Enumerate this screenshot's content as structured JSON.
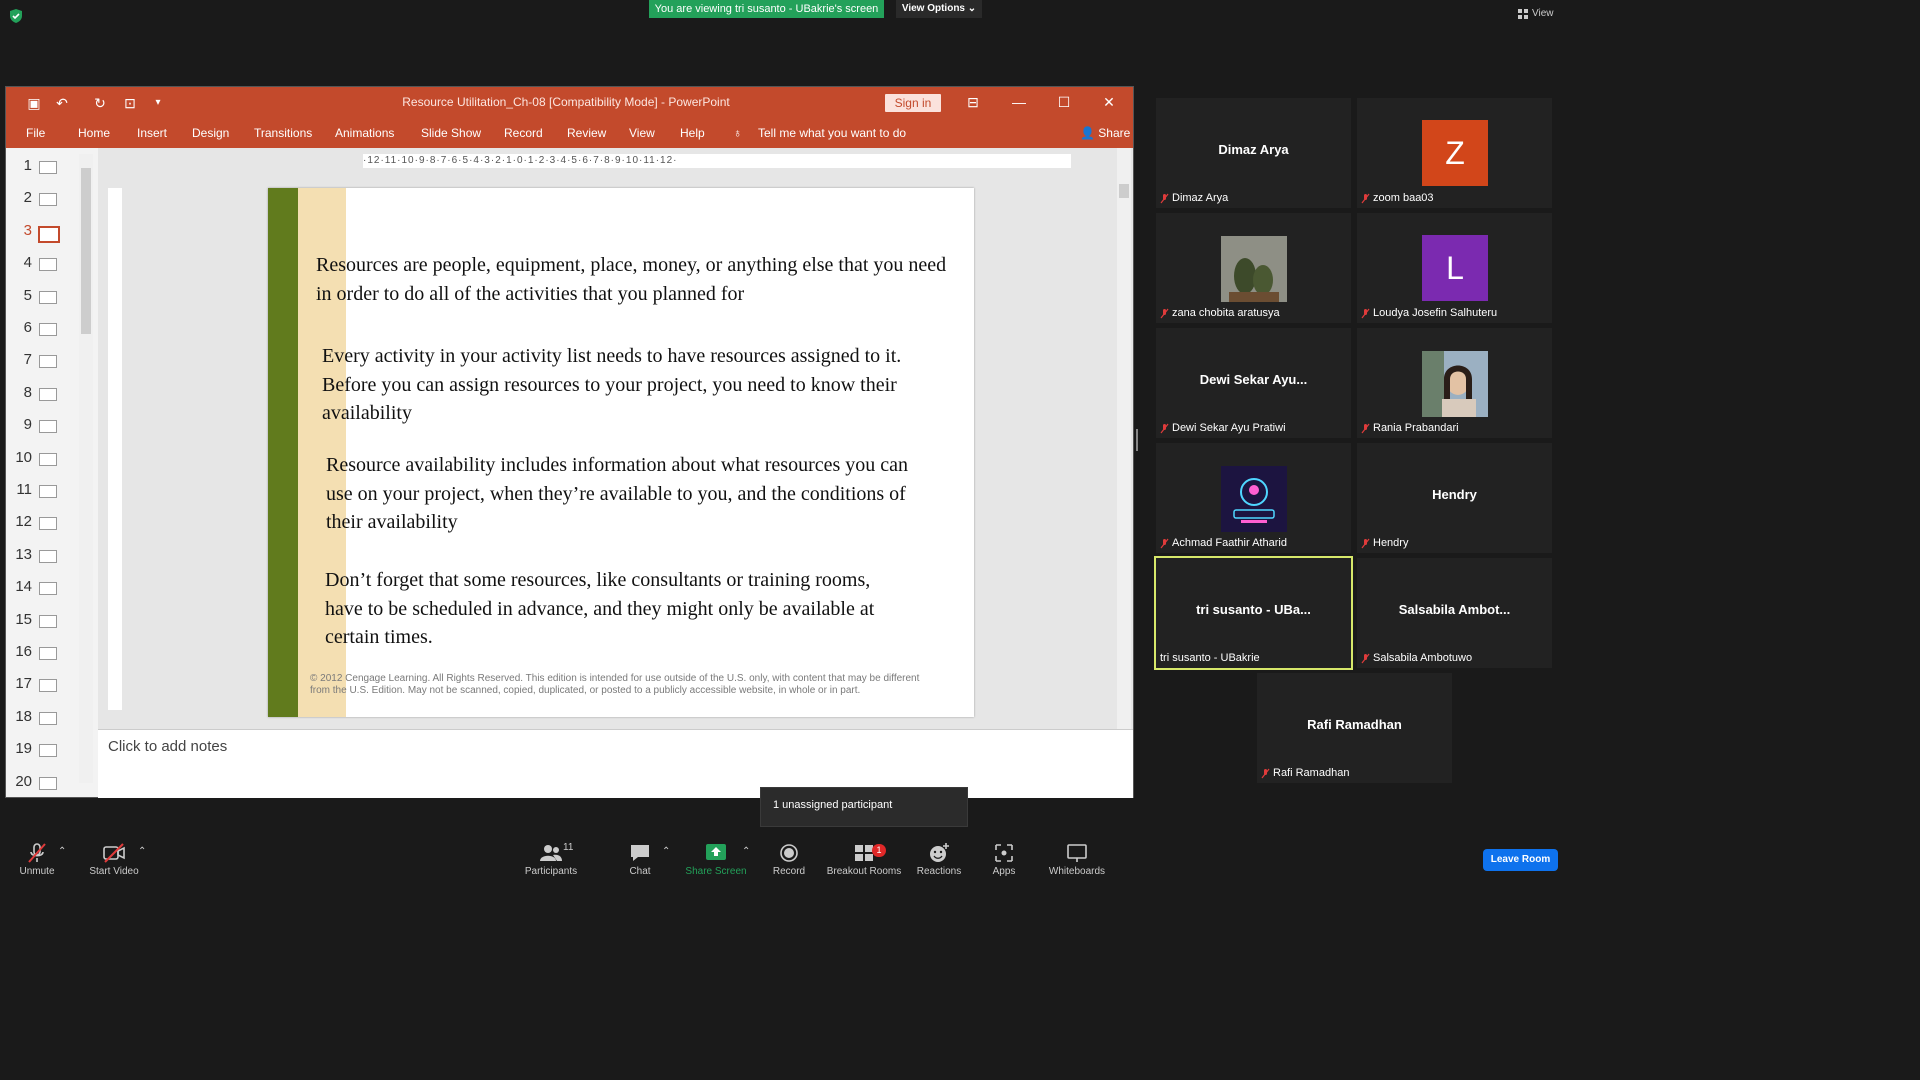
{
  "banner": {
    "viewing_text": "You are viewing tri susanto - UBakrie's screen",
    "view_options": "View Options",
    "view_label": "View"
  },
  "ppt": {
    "title": "Resource Utilitation_Ch-08 [Compatibility Mode]  -  PowerPoint",
    "sign_in": "Sign in",
    "tabs": [
      "File",
      "Home",
      "Insert",
      "Design",
      "Transitions",
      "Animations",
      "Slide Show",
      "Record",
      "Review",
      "View",
      "Help"
    ],
    "tell_me": "Tell me what you want to do",
    "share": "Share",
    "ruler": "·12·11·10·9·8·7·6·5·4·3·2·1·0·1·2·3·4·5·6·7·8·9·10·11·12·",
    "slide_numbers": [
      "1",
      "2",
      "3",
      "4",
      "5",
      "6",
      "7",
      "8",
      "9",
      "10",
      "11",
      "12",
      "13",
      "14",
      "15",
      "16",
      "17",
      "18",
      "19",
      "20"
    ],
    "selected_slide": "3",
    "slide": {
      "p1": "Resources are people, equipment, place, money, or anything else that you need in order to do all of the activities that you planned for",
      "p2": "Every activity in your activity list needs to have resources assigned to it. Before you can assign resources to your project, you need to know their availability",
      "p3": "Resource availability includes information about what resources you can use on your project, when they’re available to you, and the conditions of their availability",
      "p4": "Don’t forget that some resources, like consultants or training rooms, have to be scheduled in advance, and they might only be available at certain times.",
      "copyright": "© 2012 Cengage Learning. All Rights Reserved. This edition is intended for use outside of the U.S. only, with content that may be different from the U.S. Edition. May not be scanned, copied, duplicated, or posted to a publicly accessible website, in whole or in part."
    },
    "notes_placeholder": "Click to add notes"
  },
  "participants": [
    {
      "center": "Dimaz Arya",
      "label": "Dimaz Arya"
    },
    {
      "center": "Z",
      "label": "zoom baa03",
      "avatar_color": "#d2461a"
    },
    {
      "center": "",
      "label": "zana chobita aratusya"
    },
    {
      "center": "L",
      "label": "Loudya Josefin Salhuteru",
      "avatar_color": "#7b2ab0"
    },
    {
      "center": "Dewi Sekar Ayu...",
      "label": "Dewi Sekar Ayu Pratiwi"
    },
    {
      "center": "",
      "label": "Rania Prabandari"
    },
    {
      "center": "",
      "label": "Achmad Faathir Atharid"
    },
    {
      "center": "Hendry",
      "label": "Hendry"
    },
    {
      "center": "tri susanto - UBa...",
      "label": "tri susanto - UBakrie"
    },
    {
      "center": "Salsabila  Ambot...",
      "label": "Salsabila Ambotuwo"
    },
    {
      "center": "Rafi Ramadhan",
      "label": "Rafi Ramadhan"
    }
  ],
  "toast": "1 unassigned participant",
  "toolbar": {
    "unmute": "Unmute",
    "start_video": "Start Video",
    "participants": "Participants",
    "participants_count": "11",
    "chat": "Chat",
    "share_screen": "Share Screen",
    "record": "Record",
    "breakout_rooms": "Breakout Rooms",
    "breakout_badge": "1",
    "reactions": "Reactions",
    "apps": "Apps",
    "whiteboards": "Whiteboards",
    "leave_room": "Leave Room"
  },
  "colors": {
    "ppt_accent": "#c34a2c",
    "share_green": "#23a15a",
    "leave_blue": "#0e72ed",
    "active_speaker": "#d7e86a"
  }
}
